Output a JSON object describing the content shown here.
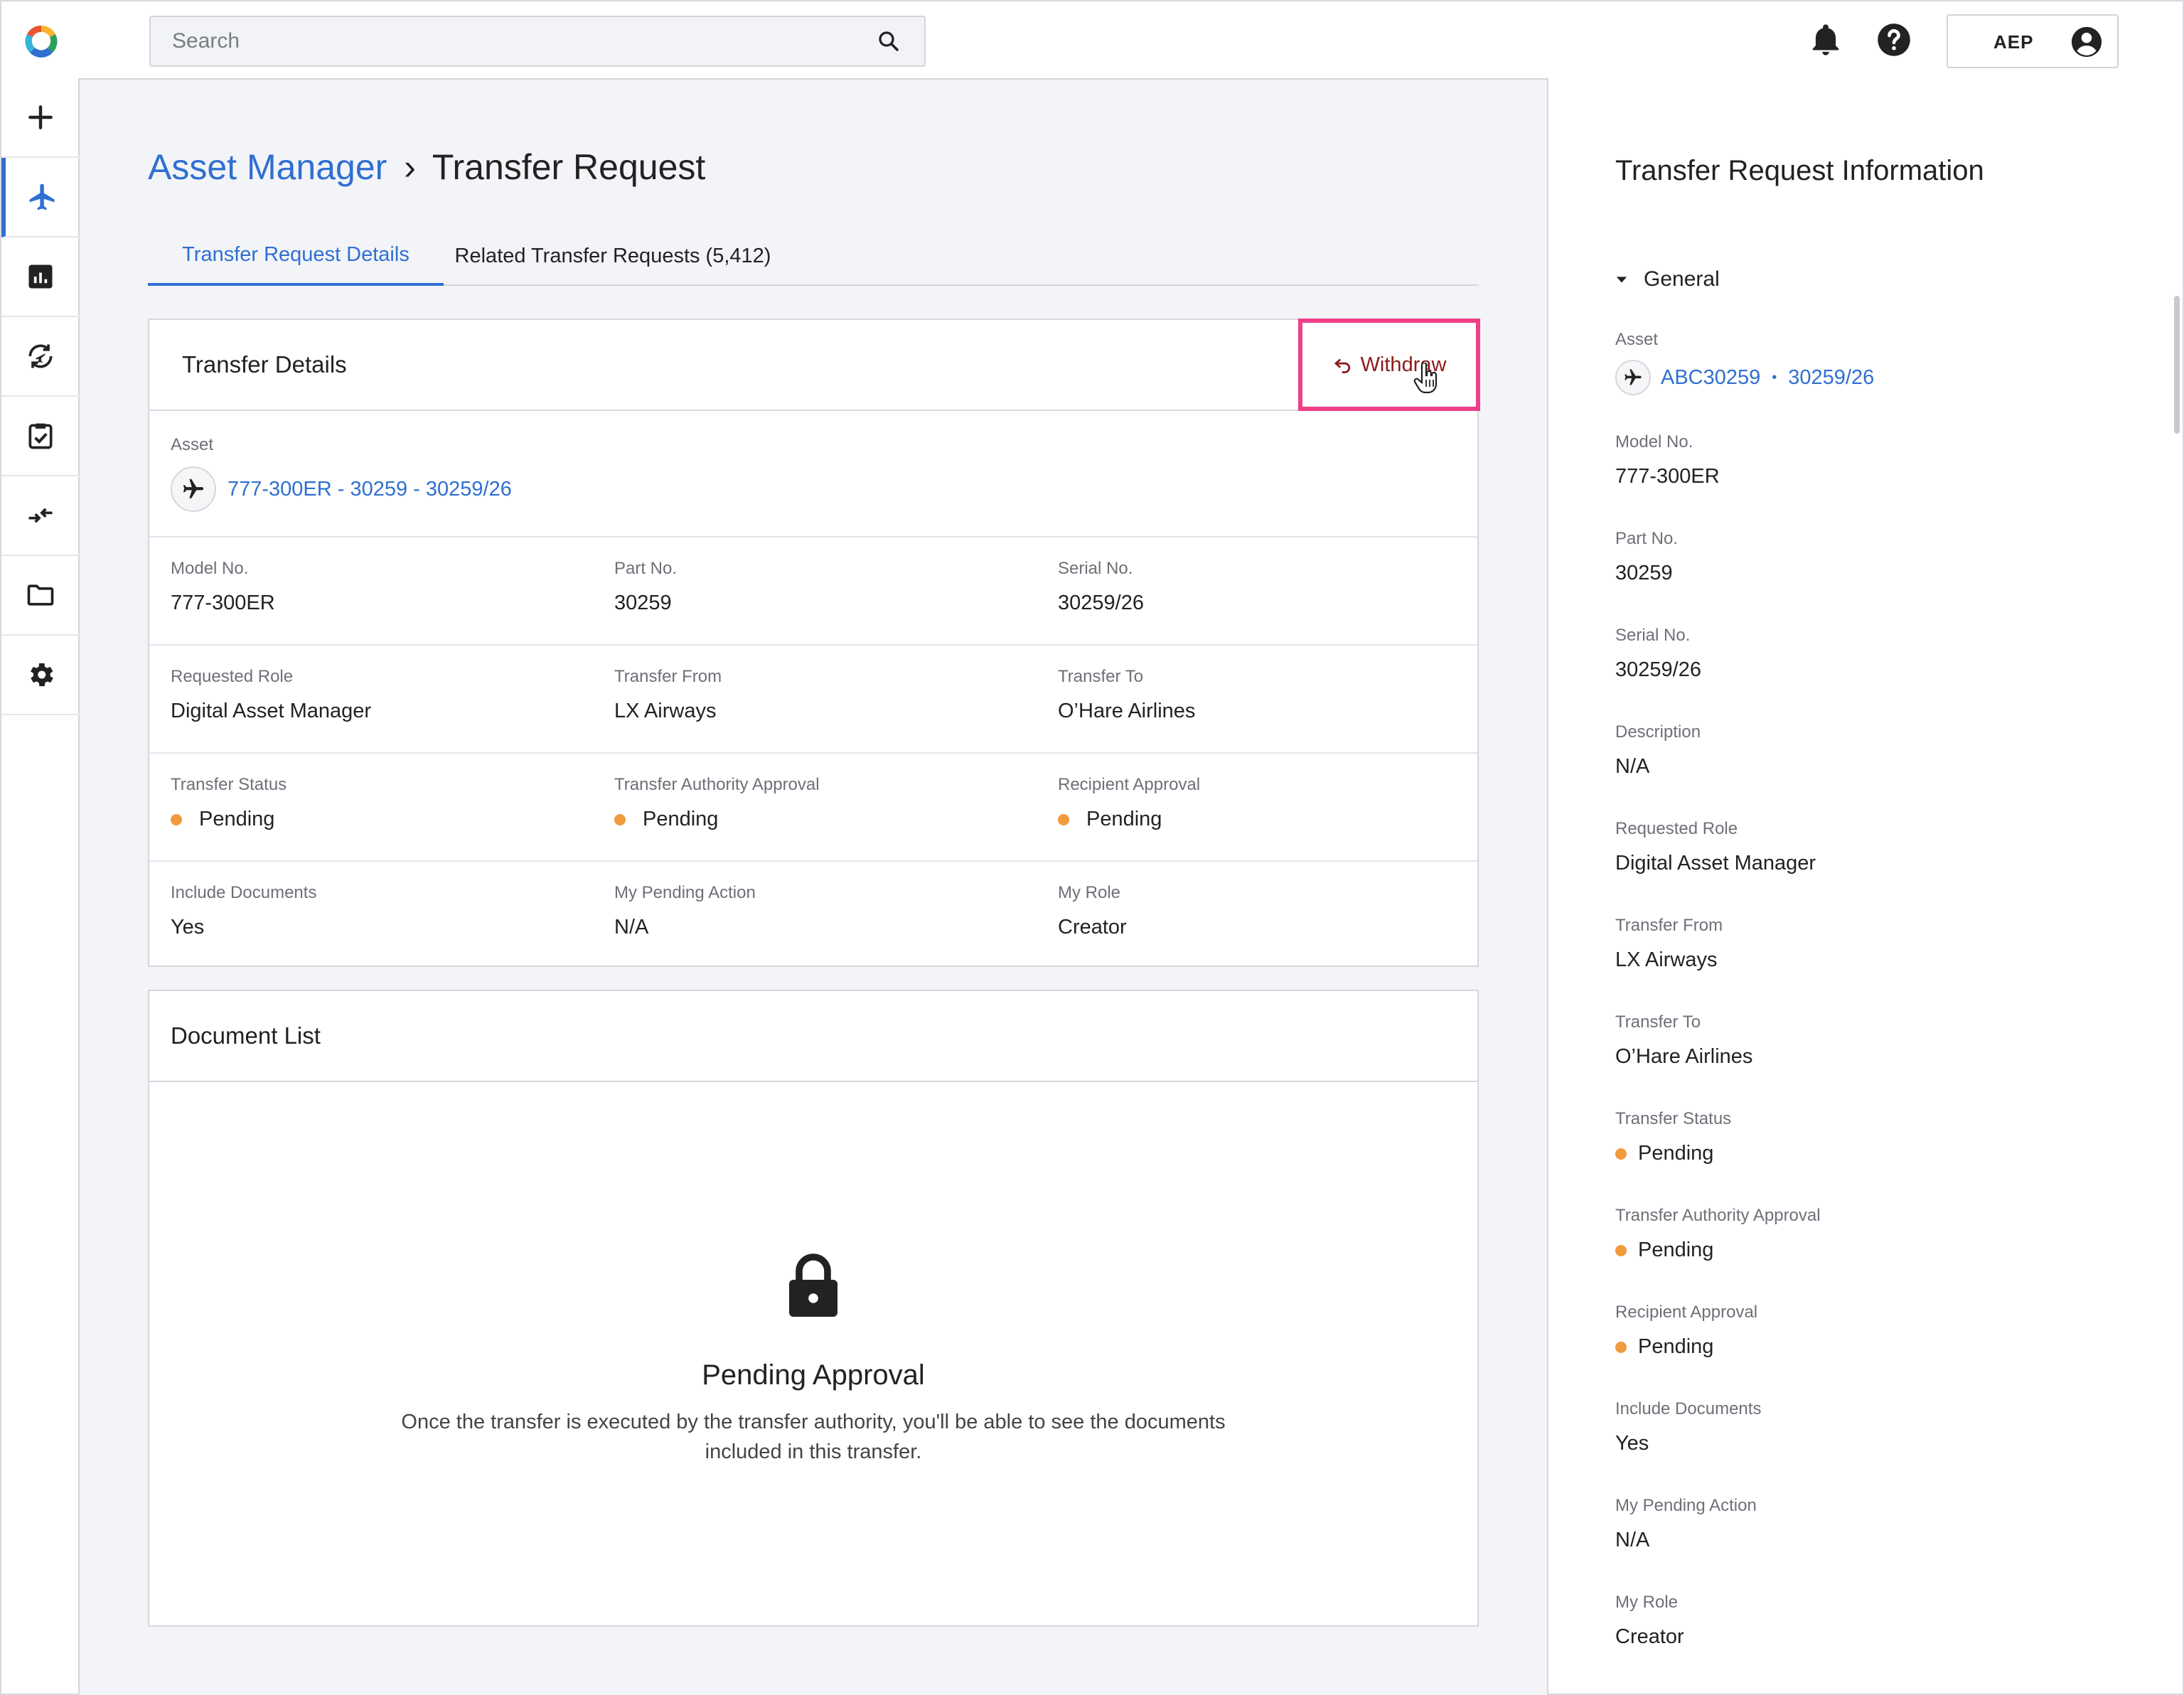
{
  "search": {
    "placeholder": "Search"
  },
  "user": {
    "code": "AEP"
  },
  "breadcrumb": {
    "parent": "Asset Manager",
    "separator": "›",
    "current": "Transfer Request"
  },
  "tabs": [
    {
      "label": "Transfer Request Details",
      "active": true
    },
    {
      "label": "Related Transfer Requests (5,412)",
      "active": false
    }
  ],
  "transfer_details": {
    "title": "Transfer Details",
    "withdraw_label": "Withdraw",
    "asset_label": "Asset",
    "asset_value": "777-300ER - 30259 - 30259/26",
    "fields": [
      {
        "label": "Model No.",
        "value": "777-300ER"
      },
      {
        "label": "Part No.",
        "value": "30259"
      },
      {
        "label": "Serial No.",
        "value": "30259/26"
      },
      {
        "label": "Requested Role",
        "value": "Digital Asset Manager"
      },
      {
        "label": "Transfer From",
        "value": "LX Airways"
      },
      {
        "label": "Transfer To",
        "value": "O’Hare Airlines"
      },
      {
        "label": "Transfer Status",
        "value": "Pending",
        "status": true
      },
      {
        "label": "Transfer Authority Approval",
        "value": "Pending",
        "status": true
      },
      {
        "label": "Recipient Approval",
        "value": "Pending",
        "status": true
      },
      {
        "label": "Include Documents",
        "value": "Yes"
      },
      {
        "label": "My Pending Action",
        "value": "N/A"
      },
      {
        "label": "My Role",
        "value": "Creator"
      }
    ]
  },
  "document_list": {
    "title": "Document List",
    "empty_title": "Pending Approval",
    "empty_text": "Once the transfer is executed by the transfer authority, you'll be able to see the documents included in this transfer."
  },
  "info_panel": {
    "title": "Transfer Request Information",
    "section": "General",
    "asset_label": "Asset",
    "asset_id": "ABC30259",
    "asset_bullet": "•",
    "asset_serial": "30259/26",
    "fields": [
      {
        "label": "Model No.",
        "value": "777-300ER"
      },
      {
        "label": "Part No.",
        "value": "30259"
      },
      {
        "label": "Serial No.",
        "value": "30259/26"
      },
      {
        "label": "Description",
        "value": "N/A"
      },
      {
        "label": "Requested Role",
        "value": "Digital Asset Manager"
      },
      {
        "label": "Transfer From",
        "value": "LX Airways"
      },
      {
        "label": "Transfer To",
        "value": "O’Hare Airlines"
      },
      {
        "label": "Transfer Status",
        "value": "Pending",
        "status": true
      },
      {
        "label": "Transfer Authority Approval",
        "value": "Pending",
        "status": true
      },
      {
        "label": "Recipient Approval",
        "value": "Pending",
        "status": true
      },
      {
        "label": "Include Documents",
        "value": "Yes"
      },
      {
        "label": "My Pending Action",
        "value": "N/A"
      },
      {
        "label": "My Role",
        "value": "Creator"
      }
    ]
  },
  "colors": {
    "accent": "#2f6fd1",
    "pending": "#f19a3e",
    "highlight": "#ee3f8a",
    "withdraw": "#8c1a1a"
  },
  "icons": {
    "rail": [
      "plus-icon",
      "airplane-icon",
      "chart-icon",
      "transfer-cycle-icon",
      "clipboard-check-icon",
      "swap-arrows-icon",
      "folder-icon",
      "gear-icon"
    ],
    "top": [
      "notification-bell-icon",
      "help-icon",
      "user-account-icon"
    ]
  }
}
